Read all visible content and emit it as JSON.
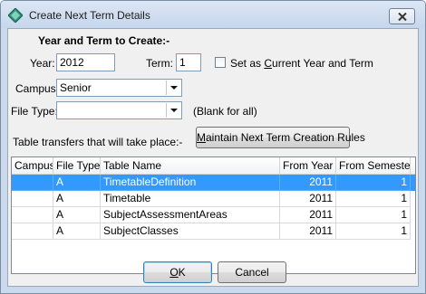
{
  "window": {
    "title": "Create Next Term Details"
  },
  "heading": "Year and Term to Create:-",
  "year": {
    "label": "Year:",
    "value": "2012"
  },
  "term": {
    "label": "Term:",
    "value": "1"
  },
  "set_current": {
    "label_pre": "Set as ",
    "label_ul": "C",
    "label_post": "urrent Year and Term",
    "checked": false
  },
  "campus": {
    "label": "Campus:",
    "value": "Senior"
  },
  "file_type": {
    "label": "File Type:",
    "value": "",
    "hint": "(Blank for all)"
  },
  "transfers_label": "Table transfers that will take place:-",
  "rules_button": {
    "label_ul": "M",
    "label_post": "aintain Next Term Creation Rules"
  },
  "table": {
    "columns": [
      "Campus",
      "File Type",
      "Table Name",
      "From Year",
      "From Semester"
    ],
    "rows": [
      {
        "campus": "",
        "file_type": "A",
        "table_name": "TimetableDefinition",
        "from_year": "2011",
        "from_semester": "1",
        "selected": true
      },
      {
        "campus": "",
        "file_type": "A",
        "table_name": "Timetable",
        "from_year": "2011",
        "from_semester": "1",
        "selected": false
      },
      {
        "campus": "",
        "file_type": "A",
        "table_name": "SubjectAssessmentAreas",
        "from_year": "2011",
        "from_semester": "1",
        "selected": false
      },
      {
        "campus": "",
        "file_type": "A",
        "table_name": "SubjectClasses",
        "from_year": "2011",
        "from_semester": "1",
        "selected": false
      }
    ]
  },
  "ok_button": {
    "label_ul": "O",
    "label_post": "K"
  },
  "cancel_button": {
    "label": "Cancel"
  },
  "colors": {
    "selection": "#3399ff",
    "titlebar": "#cad9ec"
  },
  "icons": {
    "app": "diamond-icon",
    "close": "close-icon"
  }
}
